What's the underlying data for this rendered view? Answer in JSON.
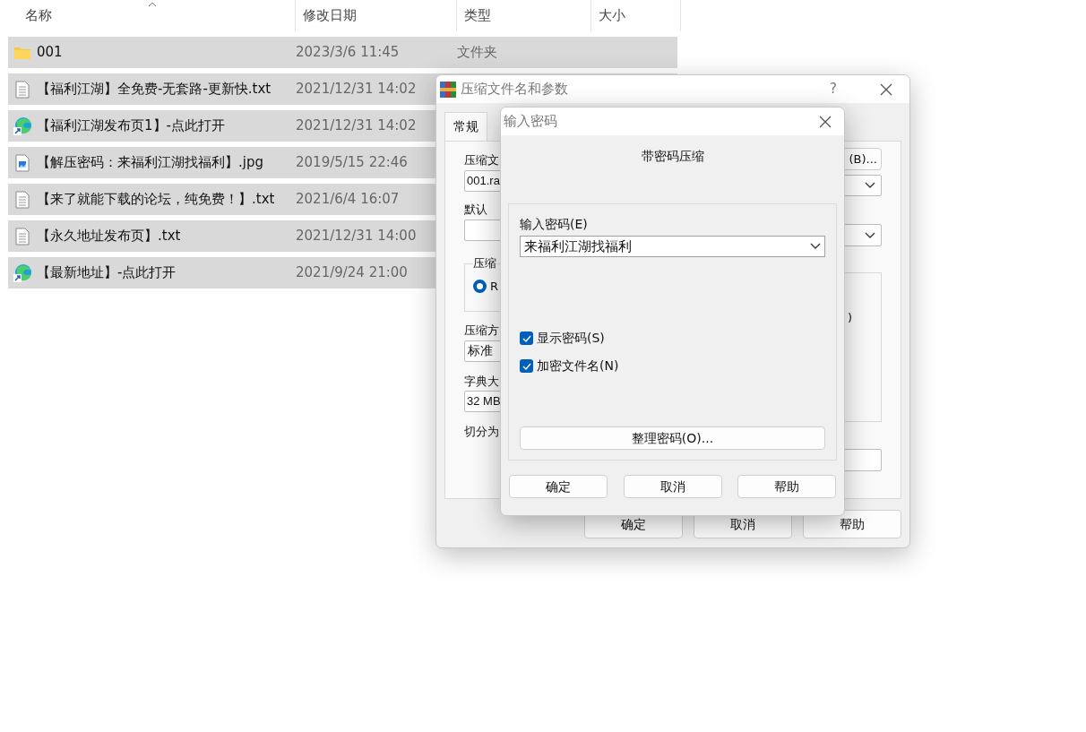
{
  "file_list": {
    "columns": [
      {
        "label": "名称",
        "sorted": true
      },
      {
        "label": "修改日期",
        "sorted": false
      },
      {
        "label": "类型",
        "sorted": false
      },
      {
        "label": "大小",
        "sorted": false
      }
    ],
    "rows": [
      {
        "kind": "folder",
        "name": "001",
        "modified": "2023/3/6 11:45",
        "type": "文件夹",
        "selected": true
      },
      {
        "kind": "text",
        "name": "【福利江湖】全免费-无套路-更新快.txt",
        "modified": "2021/12/31 14:02",
        "selected": true
      },
      {
        "kind": "shortcut",
        "name": "【福利江湖发布页1】-点此打开",
        "modified": "2021/12/31 14:02",
        "selected": true
      },
      {
        "kind": "image",
        "name": "【解压密码：来福利江湖找福利】.jpg",
        "modified": "2019/5/15 22:46",
        "selected": true
      },
      {
        "kind": "text",
        "name": "【来了就能下载的论坛，纯免费！】.txt",
        "modified": "2021/6/4 16:07",
        "selected": true
      },
      {
        "kind": "text",
        "name": "【永久地址发布页】.txt",
        "modified": "2021/12/31 14:00",
        "selected": true
      },
      {
        "kind": "shortcut",
        "name": "【最新地址】-点此打开",
        "modified": "2021/9/24 21:00",
        "selected": true
      }
    ]
  },
  "archive_dialog": {
    "title": "压缩文件名和参数",
    "help_glyph": "?",
    "tabs": [
      {
        "label": "常规",
        "selected": true
      }
    ],
    "archive_name_label": "压缩文",
    "archive_name_value": "001.ra",
    "browse_button": "(B)...",
    "profile_label": "默认",
    "format_group_label": "压缩",
    "format_option": {
      "label": "R",
      "selected": true
    },
    "options_fragment": ")",
    "method_label": "压缩方",
    "method_value": "标准",
    "dictionary_label": "字典大",
    "dictionary_value": "32 MB",
    "split_label": "切分为",
    "buttons": [
      "确定",
      "取消",
      "帮助"
    ]
  },
  "password_dialog": {
    "title": "输入密码",
    "heading": "带密码压缩",
    "password_label": "输入密码(E)",
    "password_value": "来福利江湖找福利",
    "options": [
      {
        "label": "显示密码(S)",
        "checked": true
      },
      {
        "label": "加密文件名(N)",
        "checked": true
      }
    ],
    "organize_button": "整理密码(O)...",
    "buttons": [
      "确定",
      "取消",
      "帮助"
    ]
  }
}
